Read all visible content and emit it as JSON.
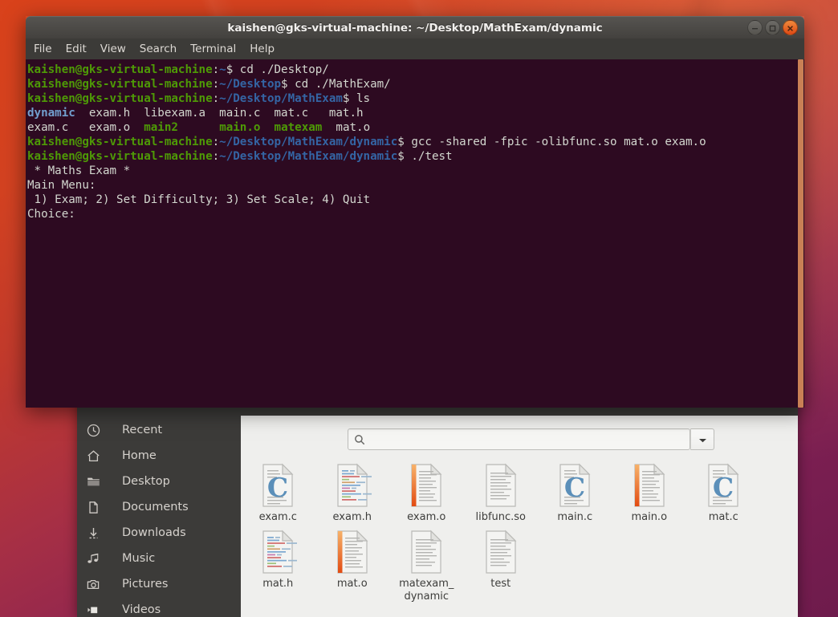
{
  "desktop": {
    "wallpaper_top_color": "#d9421b",
    "wallpaper_bottom_color": "#6e1b4c"
  },
  "terminal": {
    "title": "kaishen@gks-virtual-machine: ~/Desktop/MathExam/dynamic",
    "titlebar_color": "#4d4b47",
    "background_color": "#2d0a21",
    "prompt_color": "#4e9a06",
    "path_color": "#3465a4",
    "text_color": "#d3d7cf",
    "window_buttons": [
      {
        "name": "minimize",
        "glyph": "–"
      },
      {
        "name": "maximize",
        "glyph": "□"
      },
      {
        "name": "close",
        "glyph": "✕",
        "color": "#dd4814"
      }
    ],
    "menu": [
      {
        "label": "File"
      },
      {
        "label": "Edit"
      },
      {
        "label": "View"
      },
      {
        "label": "Search"
      },
      {
        "label": "Terminal"
      },
      {
        "label": "Help"
      }
    ],
    "lines": [
      {
        "segments": [
          {
            "text": "kaishen@gks-virtual-machine",
            "style": "prompt"
          },
          {
            "text": ":",
            "style": "plain"
          },
          {
            "text": "~",
            "style": "path"
          },
          {
            "text": "$ cd ./Desktop/",
            "style": "plain"
          }
        ]
      },
      {
        "segments": [
          {
            "text": "kaishen@gks-virtual-machine",
            "style": "prompt"
          },
          {
            "text": ":",
            "style": "plain"
          },
          {
            "text": "~/Desktop",
            "style": "path"
          },
          {
            "text": "$ cd ./MathExam/",
            "style": "plain"
          }
        ]
      },
      {
        "segments": [
          {
            "text": "kaishen@gks-virtual-machine",
            "style": "prompt"
          },
          {
            "text": ":",
            "style": "plain"
          },
          {
            "text": "~/Desktop/MathExam",
            "style": "path"
          },
          {
            "text": "$ ls",
            "style": "plain"
          }
        ]
      },
      {
        "segments": [
          {
            "text": "dynamic",
            "style": "dir"
          },
          {
            "text": "  exam.h  libexam.a  main.c  mat.c   mat.h",
            "style": "plain"
          }
        ]
      },
      {
        "segments": [
          {
            "text": "exam.c   exam.o  ",
            "style": "plain"
          },
          {
            "text": "main2",
            "style": "exec"
          },
          {
            "text": "      ",
            "style": "plain"
          },
          {
            "text": "main.o",
            "style": "exec"
          },
          {
            "text": "  ",
            "style": "plain"
          },
          {
            "text": "matexam",
            "style": "exec"
          },
          {
            "text": "  mat.o",
            "style": "plain"
          }
        ]
      },
      {
        "segments": [
          {
            "text": "kaishen@gks-virtual-machine",
            "style": "prompt"
          },
          {
            "text": ":",
            "style": "plain"
          },
          {
            "text": "~/Desktop/MathExam/dynamic",
            "style": "path"
          },
          {
            "text": "$ gcc -shared -fpic -olibfunc.so mat.o exam.o",
            "style": "plain"
          }
        ]
      },
      {
        "segments": [
          {
            "text": "kaishen@gks-virtual-machine",
            "style": "prompt"
          },
          {
            "text": ":",
            "style": "plain"
          },
          {
            "text": "~/Desktop/MathExam/dynamic",
            "style": "path"
          },
          {
            "text": "$ ./test",
            "style": "plain"
          }
        ]
      },
      {
        "segments": [
          {
            "text": " * Maths Exam *",
            "style": "plain"
          }
        ]
      },
      {
        "segments": [
          {
            "text": "Main Menu:",
            "style": "plain"
          }
        ]
      },
      {
        "segments": [
          {
            "text": " 1) Exam; 2) Set Difficulty; 3) Set Scale; 4) Quit",
            "style": "plain"
          }
        ]
      },
      {
        "segments": [
          {
            "text": "Choice:",
            "style": "plain"
          }
        ]
      }
    ]
  },
  "file_manager": {
    "sidebar": [
      {
        "label": "Recent",
        "icon": "clock-icon"
      },
      {
        "label": "Home",
        "icon": "home-icon"
      },
      {
        "label": "Desktop",
        "icon": "folder-icon"
      },
      {
        "label": "Documents",
        "icon": "document-icon"
      },
      {
        "label": "Downloads",
        "icon": "download-icon"
      },
      {
        "label": "Music",
        "icon": "music-note-icon"
      },
      {
        "label": "Pictures",
        "icon": "camera-icon"
      },
      {
        "label": "Videos",
        "icon": "video-icon"
      }
    ],
    "search": {
      "value": "",
      "placeholder": ""
    },
    "files": [
      {
        "name": "exam.c",
        "icon": "c-source-file"
      },
      {
        "name": "exam.h",
        "icon": "header-file"
      },
      {
        "name": "exam.o",
        "icon": "object-file"
      },
      {
        "name": "libfunc.so",
        "icon": "plain-text-file"
      },
      {
        "name": "main.c",
        "icon": "c-source-file"
      },
      {
        "name": "main.o",
        "icon": "object-file"
      },
      {
        "name": "mat.c",
        "icon": "c-source-file"
      },
      {
        "name": "mat.h",
        "icon": "header-file"
      },
      {
        "name": "mat.o",
        "icon": "object-file"
      },
      {
        "name": "matexam_ dynamic",
        "icon": "plain-text-file"
      },
      {
        "name": "test",
        "icon": "plain-text-file"
      }
    ]
  }
}
